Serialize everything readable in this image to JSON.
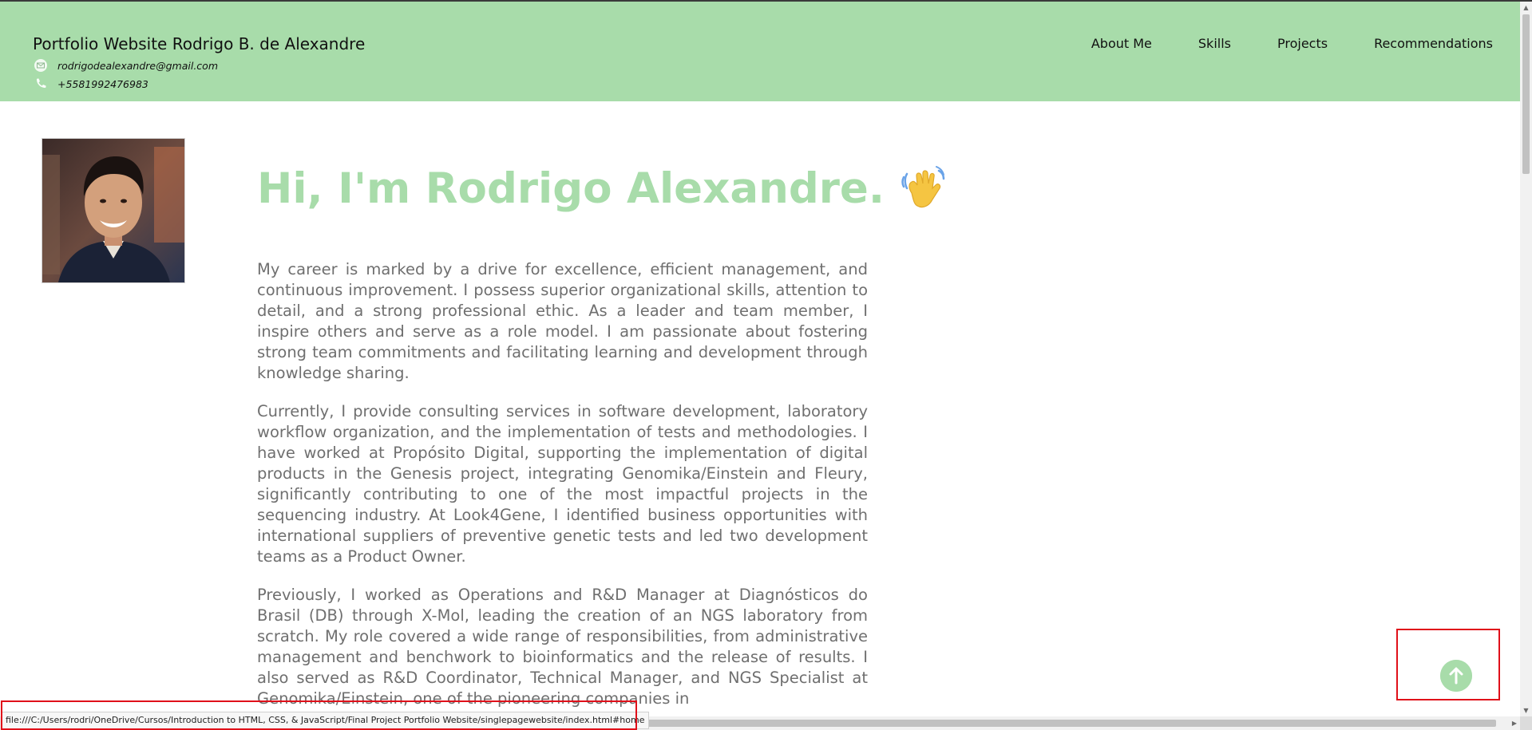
{
  "header": {
    "title": "Portfolio Website Rodrigo B. de Alexandre",
    "email": "rodrigodealexandre@gmail.com",
    "phone": "+5581992476983",
    "email_icon": "envelope-icon",
    "phone_icon": "phone-icon",
    "background_color": "#a8dcaa"
  },
  "nav": {
    "items": [
      {
        "label": "About Me"
      },
      {
        "label": "Skills"
      },
      {
        "label": "Projects"
      },
      {
        "label": "Recommendations"
      }
    ]
  },
  "profile": {
    "photo_icon": "profile-photo"
  },
  "main": {
    "title": "Hi, I'm Rodrigo Alexandre.",
    "title_icon": "waving-hand-icon",
    "accent_color": "#a8dcaa",
    "paragraphs": [
      "My career is marked by a drive for excellence, efficient management, and continuous improvement. I possess superior organizational skills, attention to detail, and a strong professional ethic. As a leader and team member, I inspire others and serve as a role model. I am passionate about fostering strong team commitments and facilitating learning and development through knowledge sharing.",
      "Currently, I provide consulting services in software development, laboratory workflow organization, and the implementation of tests and methodologies. I have worked at Propósito Digital, supporting the implementation of digital products in the Genesis project, integrating Genomika/Einstein and Fleury, significantly contributing to one of the most impactful projects in the sequencing industry. At Look4Gene, I identified business opportunities with international suppliers of preventive genetic tests and led two development teams as a Product Owner.",
      "Previously, I worked as Operations and R&D Manager at Diagnósticos do Brasil (DB) through X-Mol, leading the creation of an NGS laboratory from scratch. My role covered a wide range of responsibilities, from administrative management and benchwork to bioinformatics and the release of results. I also served as R&D Coordinator, Technical Manager, and NGS Specialist at Genomika/Einstein, one of the pioneering companies in"
    ]
  },
  "scroll_top": {
    "icon": "arrow-up-circle-icon"
  },
  "status_bar": {
    "url": "file:///C:/Users/rodri/OneDrive/Cursos/Introduction to HTML, CSS, & JavaScript/Final Project Portfolio Website/singlepagewebsite/index.html#home"
  }
}
